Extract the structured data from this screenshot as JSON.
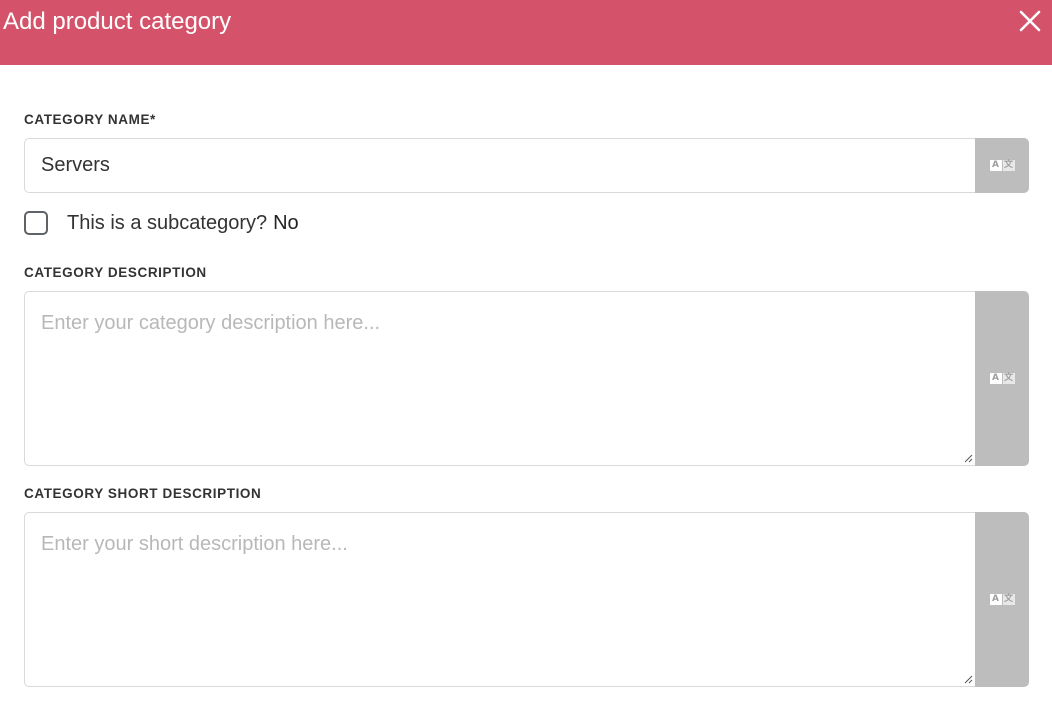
{
  "modal": {
    "title": "Add product category",
    "close_icon": "close-icon",
    "header_color": "#d4536a"
  },
  "fields": {
    "name": {
      "label": "CATEGORY NAME*",
      "value": "Servers",
      "translate_icon": "translate-icon"
    },
    "subcategory": {
      "label": "This is a subcategory?",
      "value": "No",
      "checked": false
    },
    "description": {
      "label": "CATEGORY DESCRIPTION",
      "placeholder": "Enter your category description here...",
      "translate_icon": "translate-icon"
    },
    "short_description": {
      "label": "CATEGORY SHORT DESCRIPTION",
      "placeholder": "Enter your short description here...",
      "translate_icon": "translate-icon"
    }
  }
}
